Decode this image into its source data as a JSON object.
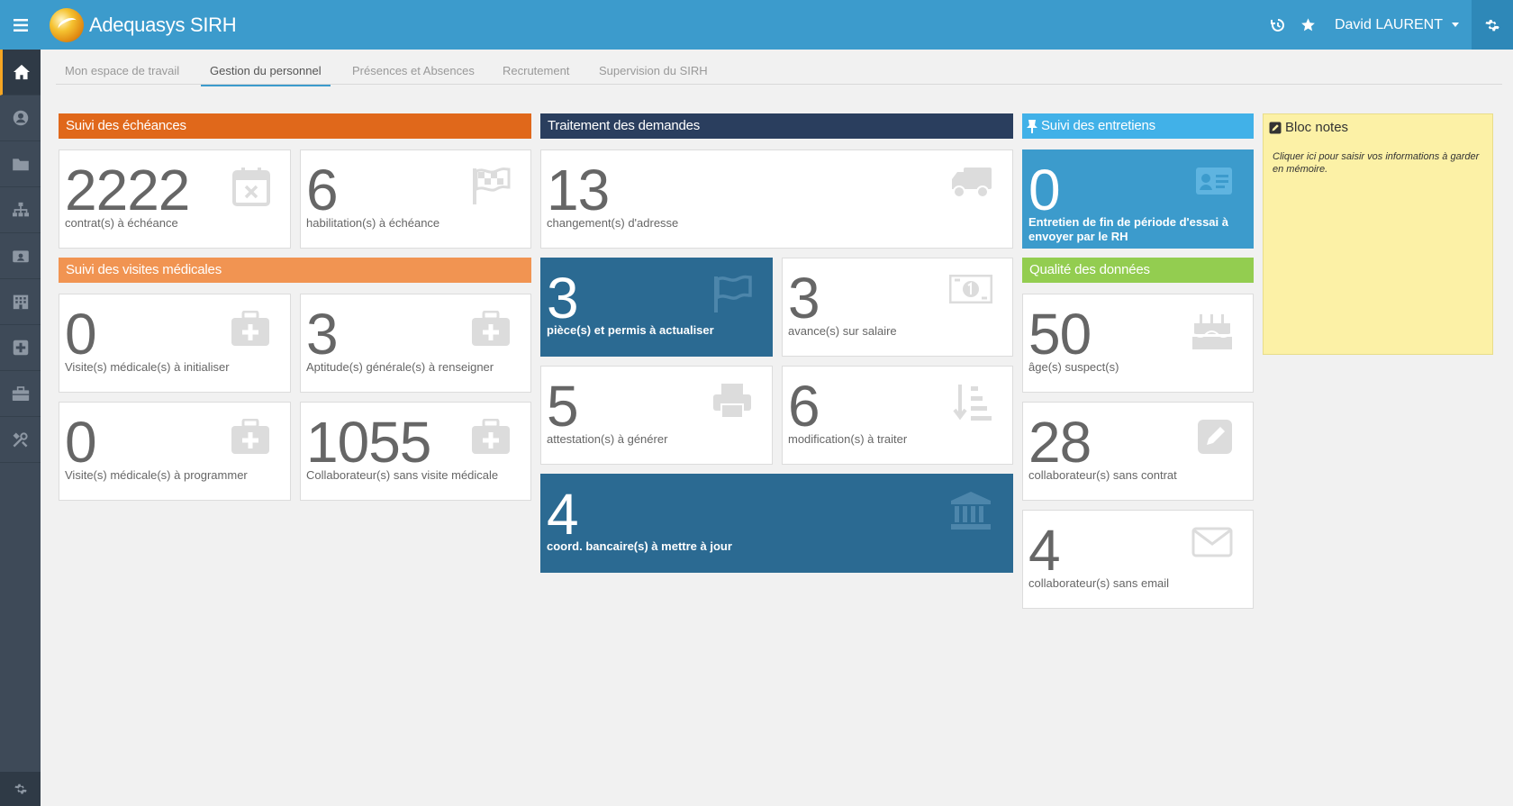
{
  "app": {
    "title": "Adequasys SIRH"
  },
  "user": {
    "name": "David LAURENT"
  },
  "tabs": [
    {
      "label": "Mon espace de travail"
    },
    {
      "label": "Gestion du personnel"
    },
    {
      "label": "Présences et Absences"
    },
    {
      "label": "Recrutement"
    },
    {
      "label": "Supervision du SIRH"
    }
  ],
  "sections": {
    "echeances": {
      "title": "Suivi des échéances",
      "color": "#e0681b",
      "tiles": [
        {
          "value": "2222",
          "label": "contrat(s) à échéance",
          "icon": "calendar-x-icon"
        },
        {
          "value": "6",
          "label": "habilitation(s) à échéance",
          "icon": "checkered-flag-icon"
        }
      ]
    },
    "visites": {
      "title": "Suivi des visites médicales",
      "color": "#f19452",
      "tiles": [
        {
          "value": "0",
          "label": "Visite(s) médicale(s) à initialiser",
          "icon": "medkit-icon"
        },
        {
          "value": "3",
          "label": "Aptitude(s) générale(s) à renseigner",
          "icon": "medkit-icon"
        },
        {
          "value": "0",
          "label": "Visite(s) médicale(s) à programmer",
          "icon": "medkit-icon"
        },
        {
          "value": "1055",
          "label": "Collaborateur(s) sans visite médicale",
          "icon": "medkit-icon"
        }
      ]
    },
    "demandes": {
      "title": "Traitement des demandes",
      "color": "#2a3e5e",
      "tiles": [
        {
          "value": "13",
          "label": "changement(s) d'adresse",
          "icon": "truck-icon"
        },
        {
          "value": "3",
          "label": "pièce(s) et permis à actualiser",
          "icon": "flag-icon"
        },
        {
          "value": "3",
          "label": "avance(s) sur salaire",
          "icon": "money-icon"
        },
        {
          "value": "5",
          "label": "attestation(s) à générer",
          "icon": "print-icon"
        },
        {
          "value": "6",
          "label": "modification(s) à traiter",
          "icon": "sort-icon"
        },
        {
          "value": "4",
          "label": "coord. bancaire(s) à mettre à jour",
          "icon": "bank-icon"
        }
      ]
    },
    "entretiens": {
      "title": "Suivi des entretiens",
      "color": "#41b1e8",
      "tiles": [
        {
          "value": "0",
          "label": "Entretien de fin de période d'essai à envoyer par le RH",
          "icon": "id-card-icon"
        }
      ]
    },
    "qualite": {
      "title": "Qualité des données",
      "color": "#93cd50",
      "tiles": [
        {
          "value": "50",
          "label": "âge(s) suspect(s)",
          "icon": "birthday-cake-icon"
        },
        {
          "value": "28",
          "label": "collaborateur(s) sans contrat",
          "icon": "pencil-square-icon"
        },
        {
          "value": "4",
          "label": "collaborateur(s) sans email",
          "icon": "envelope-icon"
        }
      ]
    }
  },
  "notes": {
    "title": "Bloc notes",
    "placeholder": "Cliquer ici pour saisir vos informations à garder en mémoire."
  }
}
